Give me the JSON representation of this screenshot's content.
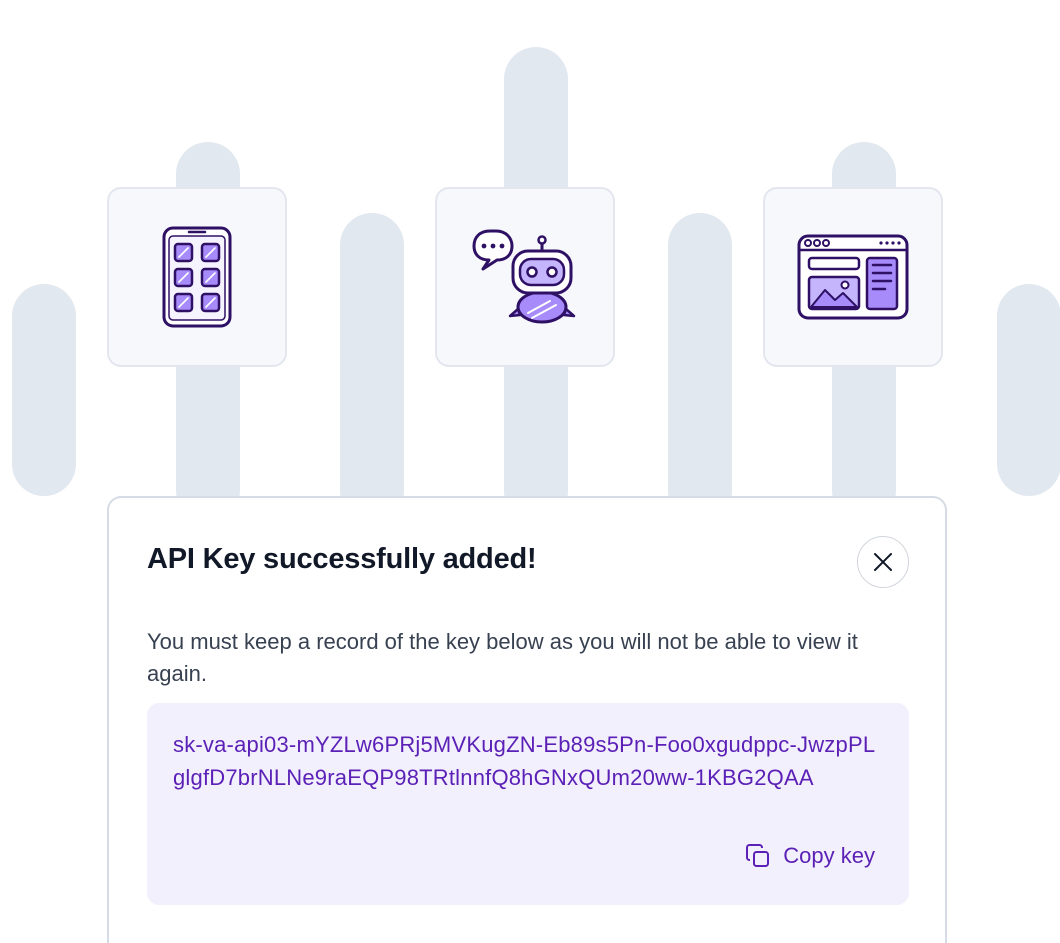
{
  "modal": {
    "title": "API Key successfully added!",
    "message": "You must keep a record of the key below as you will not be able to view it again.",
    "api_key": "sk-va-api03-mYZLw6PRj5MVKugZN-Eb89s5Pn-Foo0xgudppc-JwzpPLglgfD7brNLNe9raEQP98TRtlnnfQ8hGNxQUm20ww-1KBG2QAA",
    "copy_label": "Copy key"
  },
  "illustrations": [
    {
      "icon": "tablet-grid-icon"
    },
    {
      "icon": "chatbot-icon"
    },
    {
      "icon": "browser-window-icon"
    }
  ],
  "colors": {
    "accent": "#5b21b6",
    "icon_fill": "#a78bfa",
    "icon_stroke": "#2e1065",
    "pillar": "#e2e8f0",
    "key_background": "#f3f0fd",
    "tile_background": "#f7f8fb"
  }
}
